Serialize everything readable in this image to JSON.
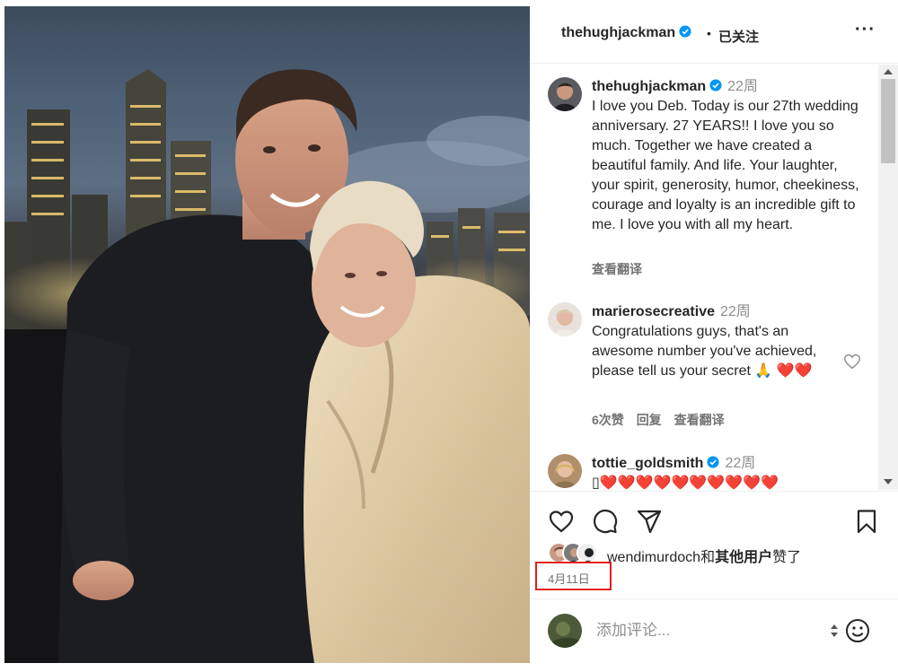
{
  "post": {
    "author": "thehughjackman",
    "follow_separator": "•",
    "follow_label": "已关注",
    "more_label": "···"
  },
  "caption": {
    "user": "thehughjackman",
    "time": "22周",
    "text": "I love you Deb. Today is our 27th wedding anniversary. 27 YEARS!! I love you so much. Together we have created a beautiful family. And life. Your laughter, your spirit, generosity, humor, cheekiness, courage and loyalty is an incredible gift to me. I love you with all my heart.",
    "translate": "查看翻译"
  },
  "comments": [
    {
      "user": "marierosecreative",
      "time": "22周",
      "text": "Congratulations guys, that's an awesome number you've achieved, please tell us your secret 🙏 ❤️❤️",
      "likes": "6次赞",
      "reply": "回复",
      "translate": "查看翻译"
    },
    {
      "user": "tottie_goldsmith",
      "time": "22周",
      "text": "▯❤️❤️❤️❤️❤️❤️❤️❤️❤️❤️"
    }
  ],
  "likes": {
    "user": "wendimurdoch",
    "joiner": "和",
    "others": "其他用户",
    "suffix": "赞了"
  },
  "date": "4月11日",
  "comment_input": {
    "placeholder": "添加评论..."
  },
  "colors": {
    "verified": "#0095f6",
    "text": "#262626",
    "secondary": "#8e8e8e",
    "highlight_box": "#e02020"
  },
  "icons": [
    "verified-icon",
    "heart-icon",
    "comment-icon",
    "share-icon",
    "bookmark-icon",
    "emoji-icon"
  ]
}
